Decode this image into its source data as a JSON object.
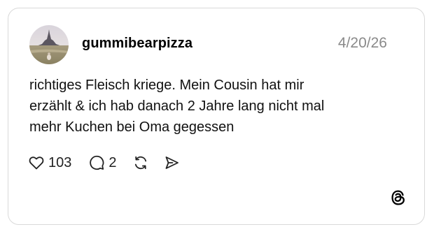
{
  "post": {
    "username": "gummibearpizza",
    "date": "4/20/26",
    "lines": [
      "richtiges Fleisch kriege. Mein Cousin hat mir",
      "erzählt & ich hab danach 2 Jahre lang nicht mal",
      "mehr Kuchen bei Oma gegessen"
    ]
  },
  "actions": {
    "like_count": "103",
    "reply_count": "2"
  },
  "icons": {
    "like": "heart-icon",
    "reply": "comment-icon",
    "repost": "repost-icon",
    "share": "send-icon",
    "brand": "threads-logo-icon"
  }
}
